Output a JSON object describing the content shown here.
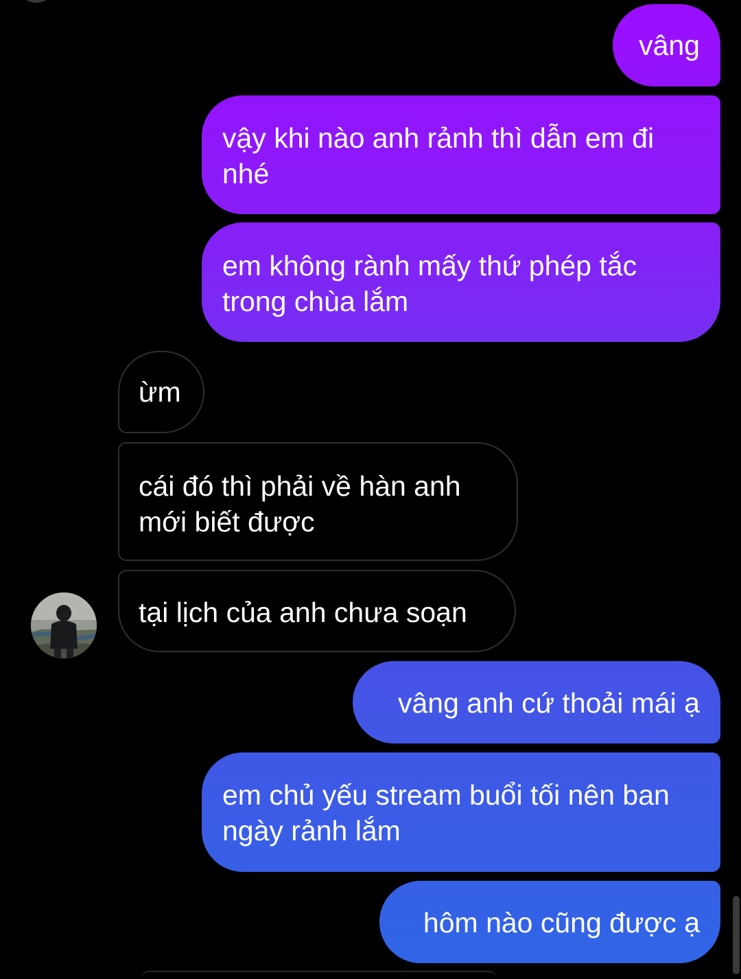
{
  "conversation": {
    "messages": [
      {
        "direction": "outgoing",
        "text": "vâng"
      },
      {
        "direction": "outgoing",
        "text": "vậy khi nào anh rảnh thì dẫn em đi nhé"
      },
      {
        "direction": "outgoing",
        "text": "em không rành mấy thứ phép tắc trong chùa lắm"
      },
      {
        "direction": "incoming",
        "text": "ừm"
      },
      {
        "direction": "incoming",
        "text": "cái đó thì phải về hàn anh mới biết được"
      },
      {
        "direction": "incoming",
        "text": "tại lịch của anh chưa soạn"
      },
      {
        "direction": "outgoing",
        "text": "vâng anh cứ thoải mái ạ"
      },
      {
        "direction": "outgoing",
        "text": "em chủ yếu stream buổi tối nên ban ngày rảnh lắm"
      },
      {
        "direction": "outgoing",
        "text": "hôm nào cũng được ạ"
      }
    ]
  },
  "colors": {
    "background": "#000000",
    "outgoing_gradient_top": "#9b0dff",
    "outgoing_gradient_bottom": "#2f66e6",
    "incoming_border": "#2f2f2f",
    "text": "#ffffff"
  },
  "icons": {
    "contact_avatar": "avatar-photo"
  }
}
